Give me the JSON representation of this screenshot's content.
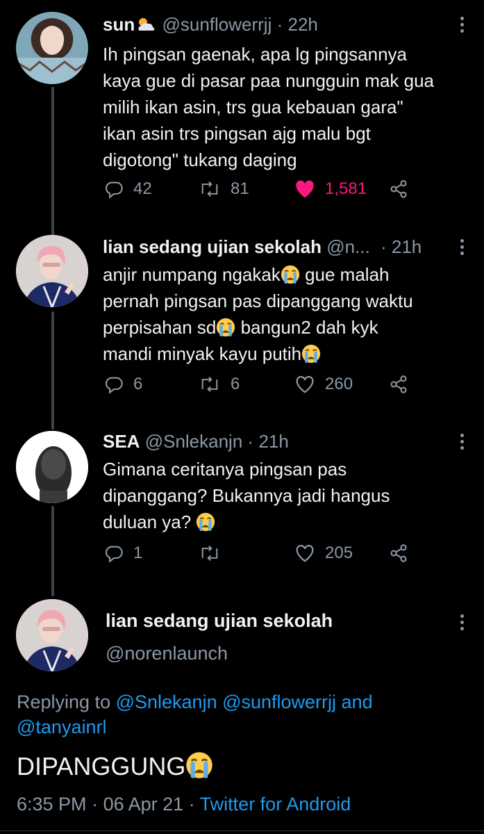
{
  "tweets": [
    {
      "name": "sun",
      "handle": "@sunflowerrjj",
      "sep": "·",
      "time": "22h",
      "lines": [
        "Ih pingsan gaenak, apa lg pingsannya",
        "kaya gue di pasar paa nungguin mak gua",
        "milih ikan asin, trs gua kebauan gara\"",
        "ikan asin trs pingsan ajg malu bgt",
        "digotong\" tukang daging"
      ],
      "replies": "42",
      "retweets": "81",
      "likes": "1,581",
      "liked": true
    },
    {
      "name": "lian sedang ujian sekolah",
      "handle": "@n...",
      "sep": "·",
      "time": "21h",
      "line1": "anjir numpang ngakak",
      "line1b": " gue malah",
      "line2": "pernah pingsan pas dipanggang waktu",
      "line3": "perpisahan sd",
      "line3b": " bangun2 dah kyk",
      "line4": "mandi minyak kayu putih",
      "replies": "6",
      "retweets": "6",
      "likes": "260"
    },
    {
      "name": "SEA",
      "handle": "@Snlekanjn",
      "sep": "·",
      "time": "21h",
      "line1": "Gimana ceritanya pingsan pas",
      "line2": "dipanggang? Bukannya jadi hangus",
      "line3": "duluan ya? ",
      "replies": "1",
      "retweets": "",
      "likes": "205"
    }
  ],
  "main": {
    "name": "lian sedang ujian sekolah",
    "handle": "@norenlaunch",
    "replying_prefix": "Replying to ",
    "replying_users1": "@Snlekanjn @sunflowerrjj",
    "replying_and": " and",
    "replying_users2": "@tanyainrl",
    "text": "DIPANGGUNG",
    "time": "6:35 PM",
    "sep1": " · ",
    "date": "06 Apr 21",
    "sep2": " · ",
    "source": "Twitter for Android"
  },
  "colors": {
    "background": "#000000",
    "text": "#f2f2f2",
    "muted": "#8b98a5",
    "link": "#1d9bf0",
    "like": "#f91880",
    "thread_line": "#38444d"
  }
}
